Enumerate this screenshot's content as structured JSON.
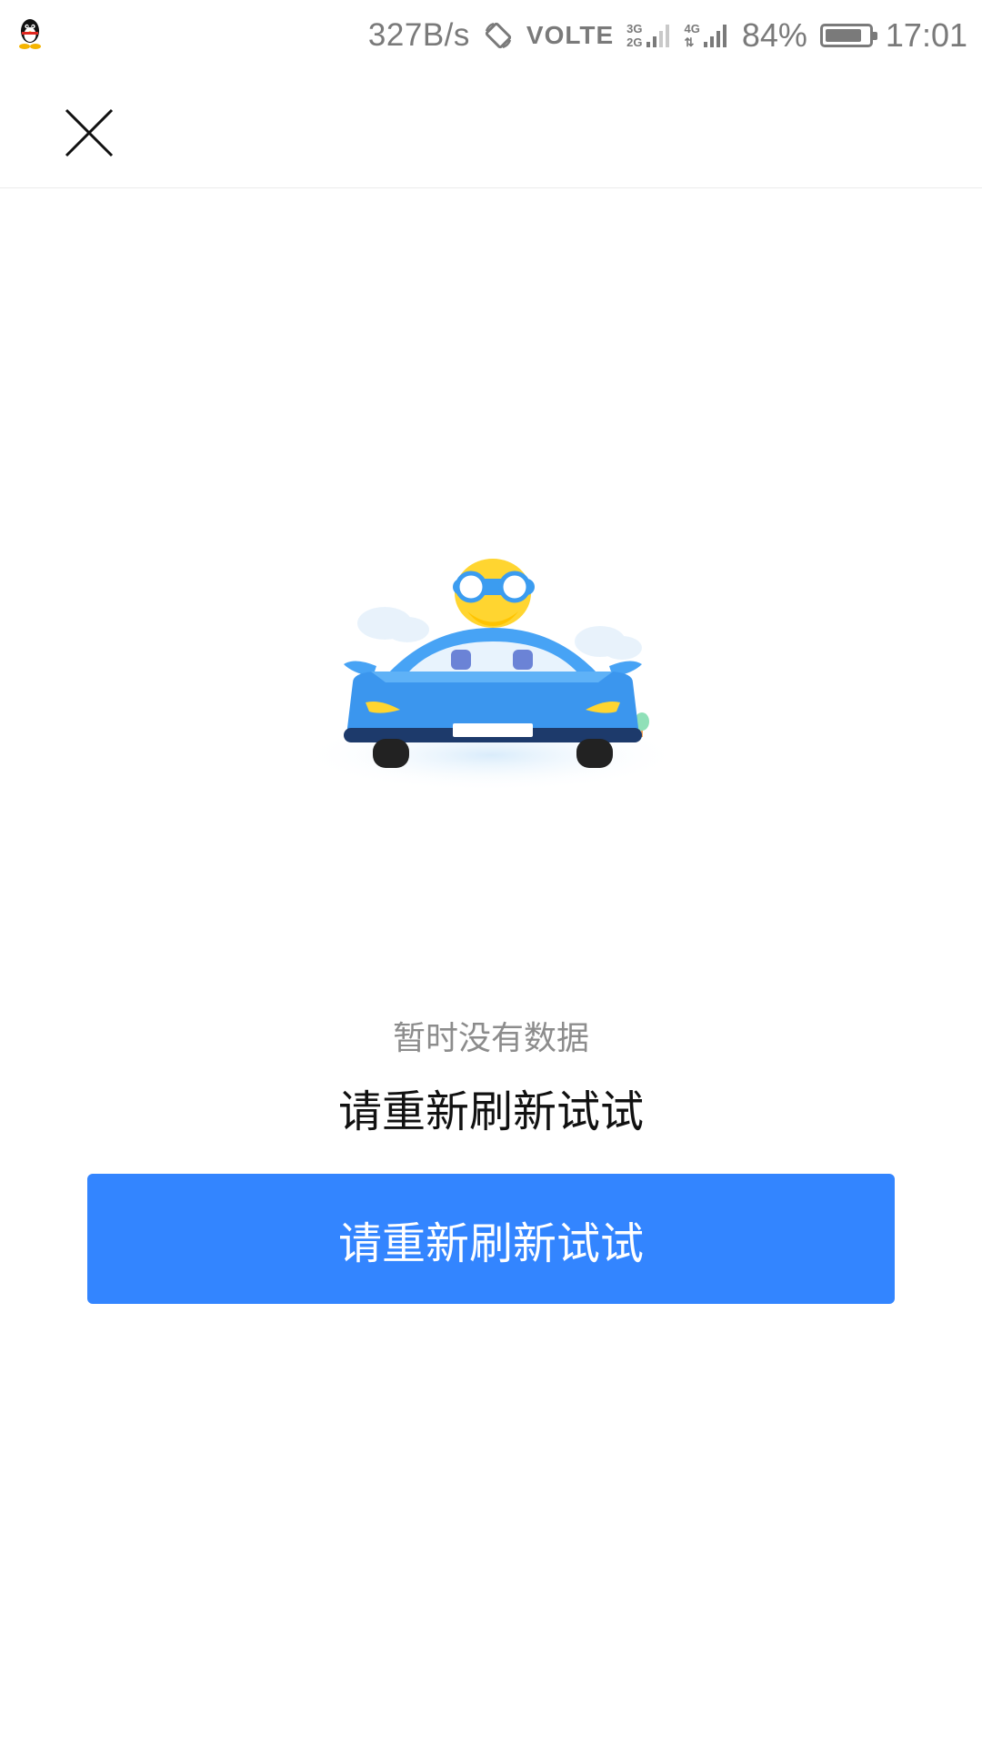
{
  "status_bar": {
    "network_speed": "327B/s",
    "volte_label": "VOLTE",
    "gen_labels_sim1": [
      "3G",
      "2G"
    ],
    "gen_label_sim2": "4G",
    "battery_percent_text": "84%",
    "battery_level": 0.84,
    "time": "17:01",
    "icons": [
      "qq-penguin-icon",
      "screen-rotation-icon",
      "signal-icon",
      "battery-icon"
    ]
  },
  "header": {
    "close_icon": "close-icon"
  },
  "empty_state": {
    "caption": "暂时没有数据",
    "message": "请重新刷新试试",
    "illustration": "car-driver-illustration"
  },
  "retry_button": {
    "label": "请重新刷新试试",
    "color": "#3385ff"
  },
  "colors": {
    "accent": "#3385ff",
    "caption": "#8c8c8c",
    "text": "#111111",
    "status_text": "#7a7a7a"
  }
}
